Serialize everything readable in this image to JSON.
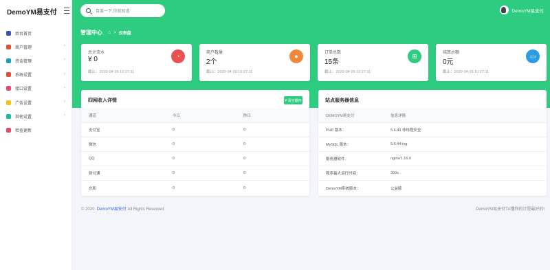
{
  "app": {
    "brand": "DemoYM易支付"
  },
  "sidebar": {
    "items": [
      {
        "label": "后台首页",
        "icon": "dashboard-icon",
        "color": "#3f51b5",
        "arrow": false
      },
      {
        "label": "商户管理",
        "icon": "users-icon",
        "color": "#e74c3c",
        "arrow": true
      },
      {
        "label": "资金管理",
        "icon": "wallet-icon",
        "color": "#17a2b8",
        "arrow": true
      },
      {
        "label": "系统设置",
        "icon": "music-icon",
        "color": "#e74c3c",
        "arrow": true
      },
      {
        "label": "接口设置",
        "icon": "interface-icon",
        "color": "#e84a6f",
        "arrow": true
      },
      {
        "label": "广告设置",
        "icon": "ad-icon",
        "color": "#f1c40f",
        "arrow": true
      },
      {
        "label": "其他设置",
        "icon": "settings-icon",
        "color": "#1abc9c",
        "arrow": true
      },
      {
        "label": "检查更新",
        "icon": "update-icon",
        "color": "#e84a6f",
        "arrow": false
      }
    ]
  },
  "header": {
    "search_placeholder": "百度一下,你就知道",
    "username": "DemoYM易支付",
    "page_title": "管理中心",
    "home_sep": ">",
    "crumb": "仪表盘"
  },
  "stats": [
    {
      "label": "总计流水",
      "value": "¥ 0",
      "time": "截止：2020-04-26 10:27:11",
      "icon": "chart-pie-icon",
      "color": "#e8524f"
    },
    {
      "label": "商户数量",
      "value": "2个",
      "time": "截止：2020-04-26 10:27:11",
      "icon": "user-icon",
      "color": "#f0883b"
    },
    {
      "label": "订单总数",
      "value": "15条",
      "time": "截止：2020-04-26 10:27:11",
      "icon": "cart-icon",
      "color": "#2ecc80"
    },
    {
      "label": "结算总额",
      "value": "0元",
      "time": "截止：2020-04-26 10:27:11",
      "icon": "card-icon",
      "color": "#2c9be5"
    }
  ],
  "income": {
    "title": "四网收入详情",
    "button": "¥ 清空缓存",
    "headers": [
      "通道",
      "今日",
      "昨日"
    ],
    "rows": [
      [
        "支付宝",
        "0",
        "0"
      ],
      [
        "微信",
        "0",
        "0"
      ],
      [
        "QQ",
        "0",
        "0"
      ],
      [
        "财付通",
        "0",
        "0"
      ],
      [
        "总和",
        "0",
        "0"
      ]
    ]
  },
  "server": {
    "title": "站点服务器信息",
    "headers": [
      "DEMOYM易支付",
      "信息详情"
    ],
    "rows": [
      [
        "PHP 版本：",
        "5.6.40 非线程安全"
      ],
      [
        "MySQL 版本：",
        "5.6.44-log"
      ],
      [
        "服务器软件：",
        "nginx/1.16.0"
      ],
      [
        "程序最大运行时间：",
        "300s"
      ],
      [
        "DemoYM系统版本：",
        "公益版"
      ]
    ]
  },
  "footer": {
    "prefix": "© 2020.",
    "link": "DemoYM易支付",
    "suffix": "All Rights Reserved.",
    "right": "DemoYM易支付TA懂你的计是最好的!"
  }
}
